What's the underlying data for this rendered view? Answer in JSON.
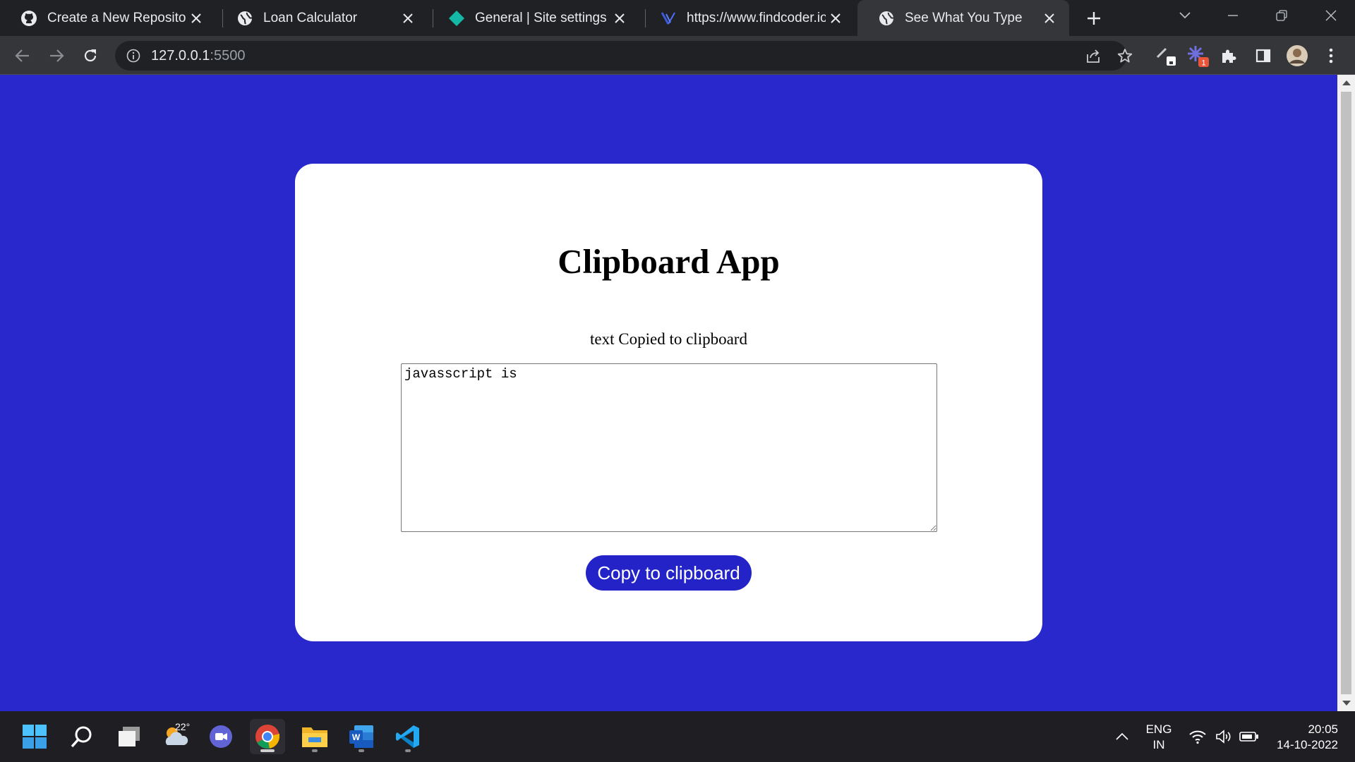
{
  "browser": {
    "tabs": [
      {
        "label": "Create a New Repository",
        "icon": "github-icon"
      },
      {
        "label": "Loan Calculator",
        "icon": "globe-icon"
      },
      {
        "label": "General | Site settings",
        "icon": "diamond-icon"
      },
      {
        "label": "https://www.findcoder.io/",
        "icon": "findcoder-icon"
      },
      {
        "label": "See What You Type",
        "icon": "globe-icon",
        "active": true
      }
    ],
    "address": {
      "host": "127.0.0.1",
      "port": ":5500"
    }
  },
  "page": {
    "title": "Clipboard App",
    "status": "text Copied to clipboard",
    "textarea_value": "javasscript is",
    "button_label": "Copy to clipboard",
    "colors": {
      "background": "#2828cc",
      "card": "#ffffff",
      "button": "#2323c8"
    }
  },
  "taskbar": {
    "weather_temp": "22°",
    "extension_badge": "1",
    "language_line1": "ENG",
    "language_line2": "IN",
    "time": "20:05",
    "date": "14-10-2022"
  }
}
